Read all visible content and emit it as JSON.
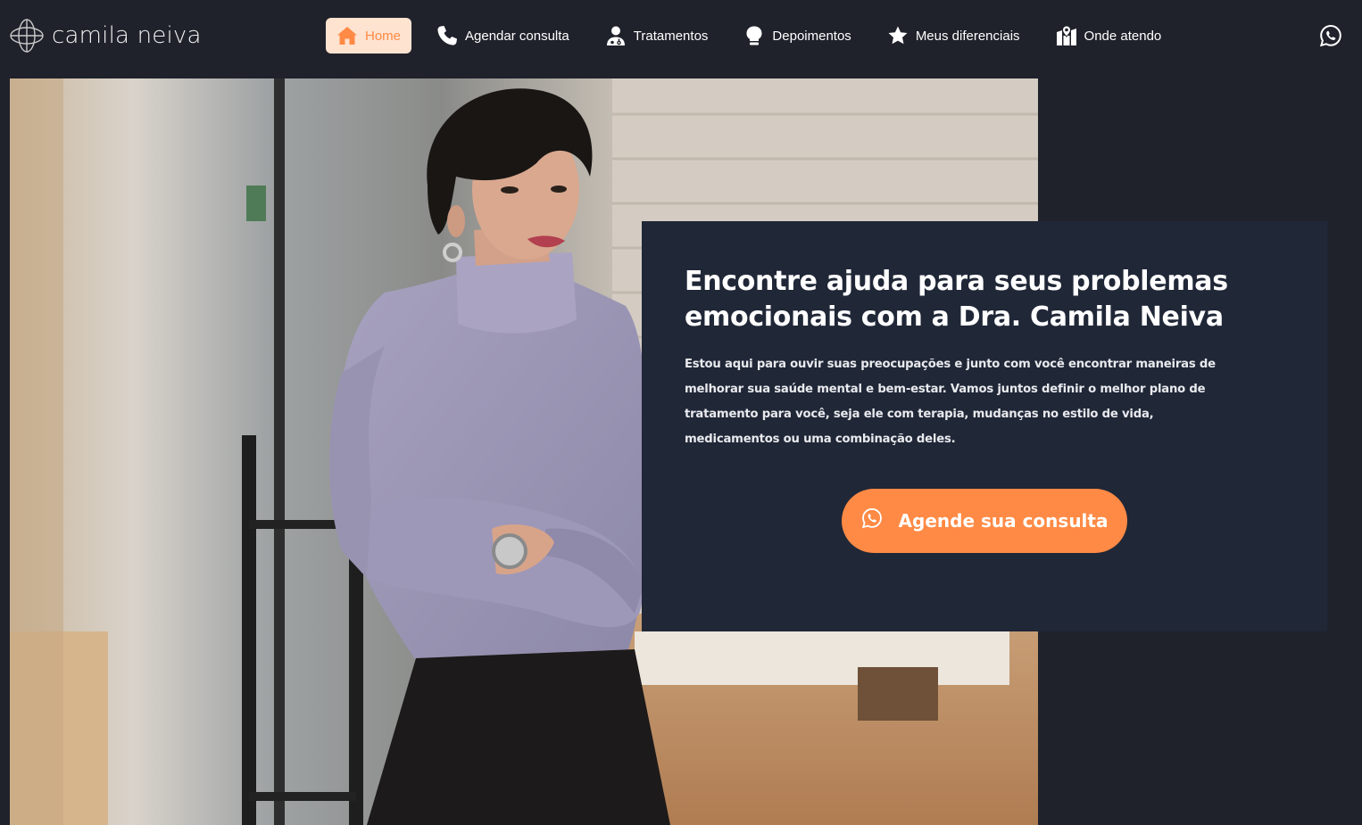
{
  "brand": {
    "name": "camila neiva"
  },
  "nav": {
    "items": [
      {
        "label": "Home",
        "icon": "home-icon",
        "active": true
      },
      {
        "label": "Agendar consulta",
        "icon": "phone-icon",
        "active": false
      },
      {
        "label": "Tratamentos",
        "icon": "doctor-icon",
        "active": false
      },
      {
        "label": "Depoimentos",
        "icon": "speech-head-icon",
        "active": false
      },
      {
        "label": "Meus diferenciais",
        "icon": "star-icon",
        "active": false
      },
      {
        "label": "Onde atendo",
        "icon": "map-marker-icon",
        "active": false
      }
    ],
    "whatsapp_icon": "whatsapp-icon"
  },
  "hero": {
    "title": "Encontre ajuda para seus problemas emocionais com a Dra. Camila Neiva",
    "text": "Estou aqui para ouvir suas preocupações e junto com você encontrar maneiras de melhorar sua saúde mental e bem-estar. Vamos juntos definir o melhor plano de tratamento para você, seja ele com terapia, mudanças no estilo de vida, medicamentos ou uma combinação deles.",
    "cta_label": "Agende sua consulta",
    "cta_icon": "whatsapp-icon"
  },
  "colors": {
    "background": "#1f222b",
    "panel": "#202737",
    "accent": "#ff8a45",
    "active_nav_bg": "#ffe3d1"
  }
}
